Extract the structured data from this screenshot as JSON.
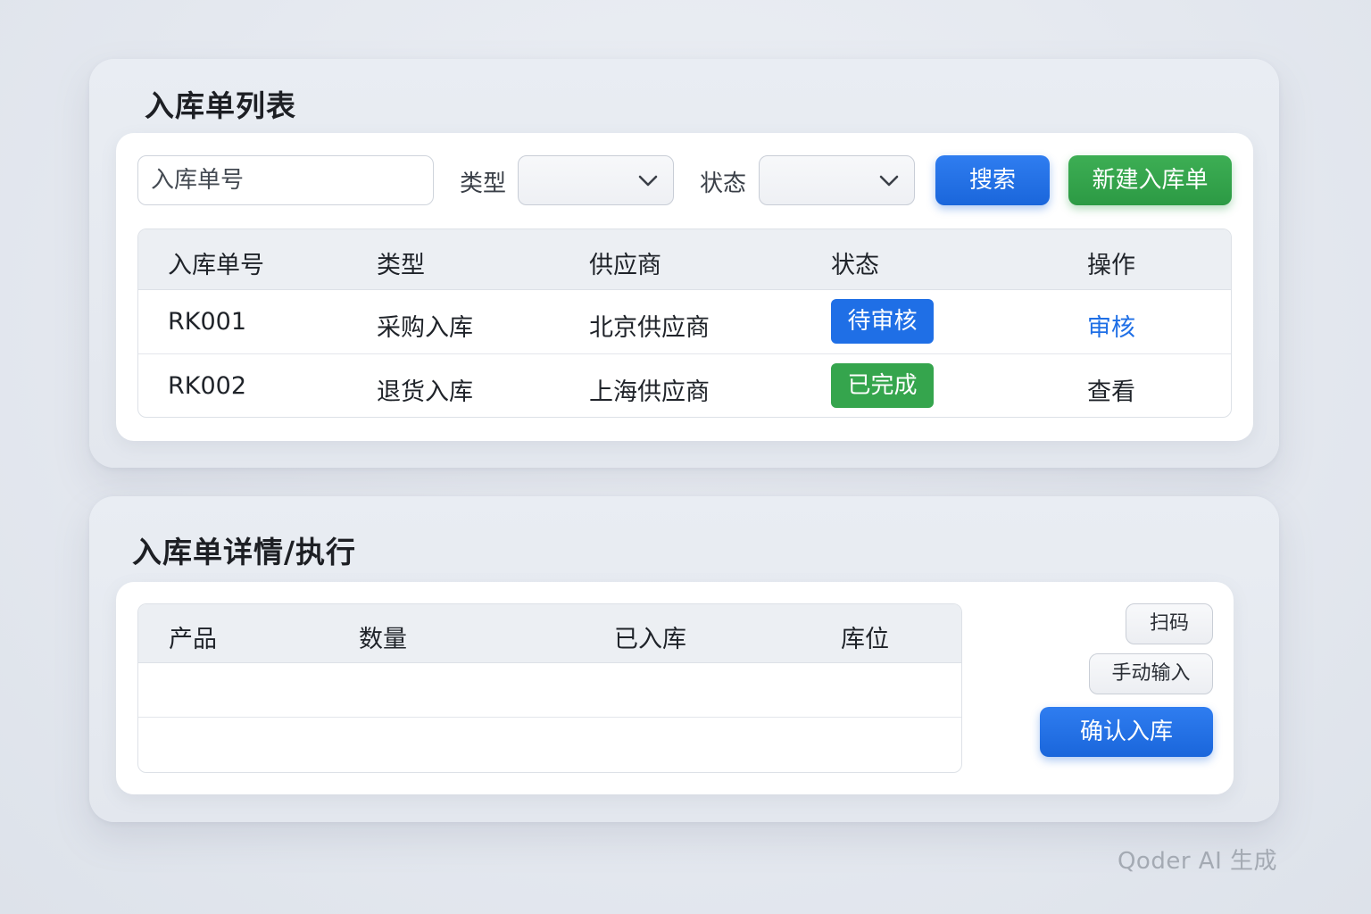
{
  "list_panel": {
    "title": "入库单列表",
    "search": {
      "placeholder": "入库单号",
      "value": ""
    },
    "type_filter": {
      "label": "类型",
      "selected": ""
    },
    "status_filter": {
      "label": "状态",
      "selected": ""
    },
    "search_button": "搜索",
    "new_button": "新建入库单",
    "table": {
      "headers": [
        "入库单号",
        "类型",
        "供应商",
        "状态",
        "操作"
      ],
      "rows": [
        {
          "id": "RK001",
          "type": "采购入库",
          "supplier": "北京供应商",
          "status": "待审核",
          "status_color": "#1f6fe6",
          "action": "审核"
        },
        {
          "id": "RK002",
          "type": "退货入库",
          "supplier": "上海供应商",
          "status": "已完成",
          "status_color": "#35a54d",
          "action": "查看"
        }
      ]
    }
  },
  "detail_panel": {
    "title": "入库单详情/执行",
    "table": {
      "headers": [
        "产品",
        "数量",
        "已入库",
        "库位"
      ]
    },
    "scan_button": "扫码",
    "manual_button": "手动输入",
    "confirm_button": "确认入库"
  },
  "watermark": "Qoder AI 生成",
  "colors": {
    "primary": "#1f6fe6",
    "success": "#35a54d"
  }
}
